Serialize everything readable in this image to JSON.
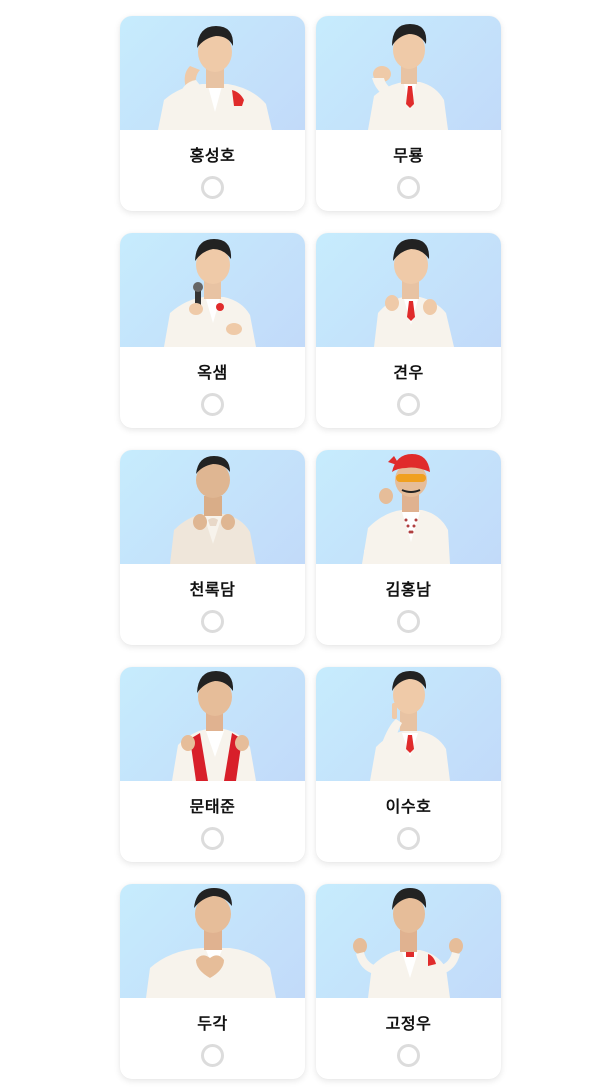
{
  "candidates": [
    {
      "name": "홍성호",
      "selected": false,
      "pose": "hand-on-head",
      "accent": "#e02b2b"
    },
    {
      "name": "무룡",
      "selected": false,
      "pose": "finger-heart",
      "accent": "#e02b2b"
    },
    {
      "name": "옥샘",
      "selected": false,
      "pose": "microphone",
      "accent": "#e02b2b"
    },
    {
      "name": "견우",
      "selected": false,
      "pose": "two-hands",
      "accent": "#e02b2b"
    },
    {
      "name": "천록담",
      "selected": false,
      "pose": "two-hands",
      "accent": "#e8d8c8"
    },
    {
      "name": "김홍남",
      "selected": false,
      "pose": "bandana",
      "accent": "#e02b2b"
    },
    {
      "name": "문태준",
      "selected": false,
      "pose": "red-lapels",
      "accent": "#d81f2a"
    },
    {
      "name": "이수호",
      "selected": false,
      "pose": "finger-lips",
      "accent": "#e02b2b"
    },
    {
      "name": "두각",
      "selected": false,
      "pose": "heart-hands",
      "accent": "#ffffff"
    },
    {
      "name": "고정우",
      "selected": false,
      "pose": "two-hands-wide",
      "accent": "#e02b2b"
    }
  ],
  "colors": {
    "photo_bg_start": "#c6ecfd",
    "photo_bg_end": "#c2daf9",
    "radio_border": "#dcdcdc",
    "name_text": "#111111"
  }
}
